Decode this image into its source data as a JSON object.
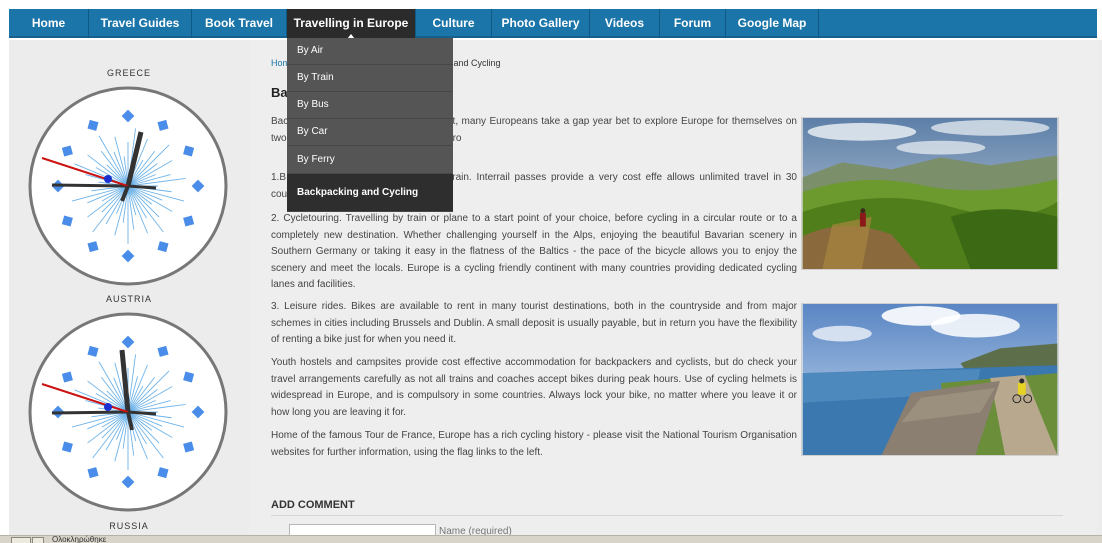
{
  "nav": {
    "items": [
      {
        "label": "Home"
      },
      {
        "label": "Travel Guides"
      },
      {
        "label": "Book Travel"
      },
      {
        "label": "Travelling in Europe"
      },
      {
        "label": "Culture"
      },
      {
        "label": "Photo Gallery"
      },
      {
        "label": "Videos"
      },
      {
        "label": "Forum"
      },
      {
        "label": "Google Map"
      }
    ],
    "active_label": "Travelling in Europe"
  },
  "dropdown": {
    "items": [
      {
        "label": "By Air"
      },
      {
        "label": "By Train"
      },
      {
        "label": "By Bus"
      },
      {
        "label": "By Car"
      },
      {
        "label": "By Ferry"
      },
      {
        "label": "Backpacking and Cycling"
      }
    ],
    "active_label": "Backpacking and Cycling"
  },
  "clocks": {
    "greece": {
      "label": "GREECE"
    },
    "austria": {
      "label": "AUSTRIA"
    },
    "russia": {
      "label": "RUSSIA"
    }
  },
  "content": {
    "breadcrumb": {
      "home": "Hom",
      "current": "ng and Cycling"
    },
    "title": "Ba",
    "paragraphs": [
      "Bac the best ways to see Europe. In fact, many Europeans take a gap year bet to explore Europe for themselves on two feet or two wheels. There are three bro",
      "1.B d heading off by plane, coach or train. Interrail passes provide a very cost effe allows unlimited travel in 30 countries.",
      "2. Cycletouring. Travelling by train or plane to a start point of your choice, before cycling in a circular route or to a completely new destination. Whether challenging yourself in the Alps, enjoying the beautiful Bavarian scenery in Southern Germany or taking it easy in the flatness of the Baltics - the pace of the bicycle allows you to enjoy the scenery and meet the locals. Europe is a cycling friendly continent with many countries providing dedicated cycling lanes and facilities.",
      "3. Leisure rides. Bikes are available to rent in many tourist destinations, both in the countryside and from major schemes in cities including Brussels and Dublin. A small deposit is usually payable, but in return you have the flexibility of renting a bike just for when you need it.",
      "Youth hostels and campsites provide cost effective accommodation for backpackers and cyclists, but do check your travel arrangements carefully as not all trains and coaches accept bikes during peak hours. Use of cycling helmets is widespread in Europe, and is compulsory in some countries. Always lock your bike, no matter where you leave it or how long you are leaving it for.",
      "Home of the famous Tour de France, Europe has a rich cycling history - please visit the National Tourism Organisation websites for further information, using the flag links to the left."
    ],
    "comment_heading": "ADD COMMENT",
    "name_label": "Name (required)",
    "name_value": ""
  },
  "statusbar": {
    "text": "Ολοκληρώθηκε"
  },
  "colors": {
    "nav_bg": "#1c75a9",
    "dropdown_bg": "#555555",
    "clock_ring": "#777777",
    "clock_dot": "#4a8de8",
    "clock_ray": "#6fb3e8"
  }
}
